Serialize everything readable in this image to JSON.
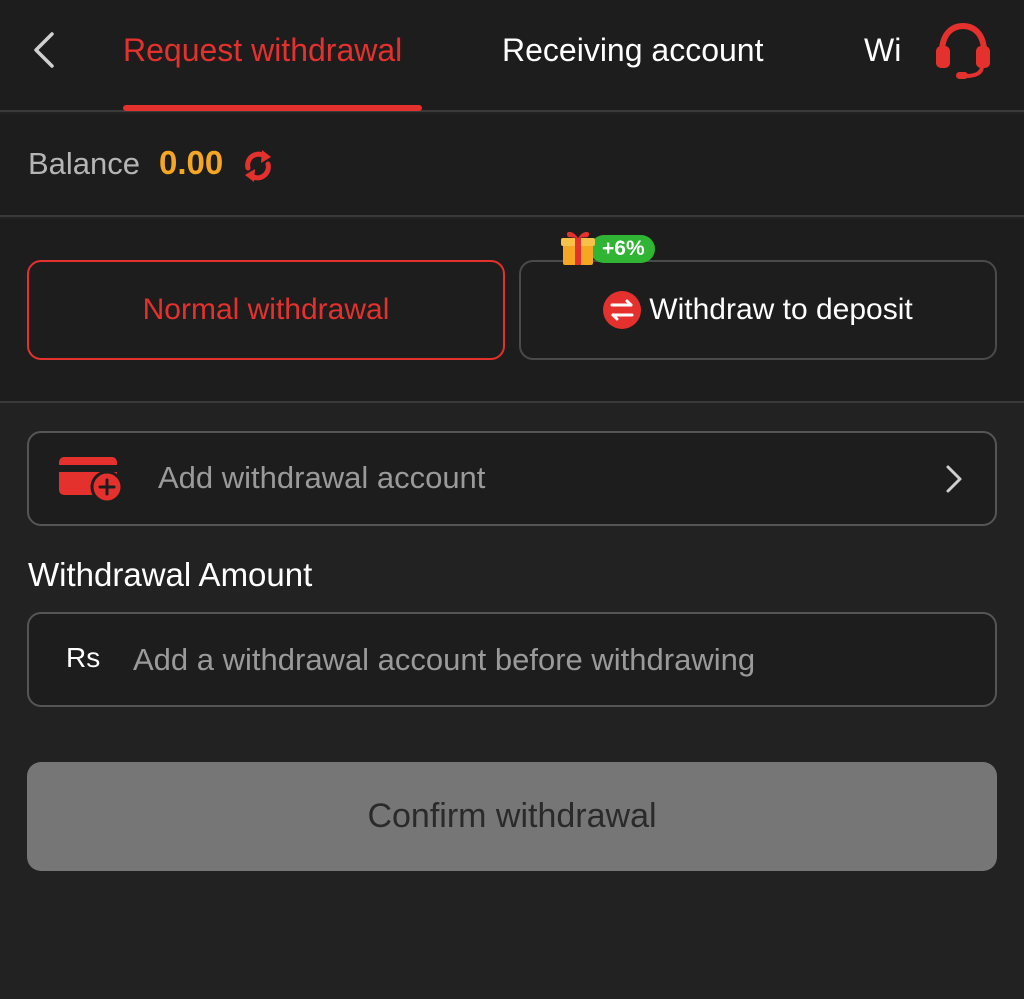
{
  "header": {
    "tabs": [
      {
        "label": "Request withdrawal",
        "active": true
      },
      {
        "label": "Receiving account",
        "active": false
      },
      {
        "label": "Wi",
        "active": false
      }
    ],
    "back_icon": "chevron-left-icon",
    "support_icon": "headset-icon"
  },
  "balance": {
    "label": "Balance",
    "value": "0.00",
    "refresh_icon": "refresh-icon"
  },
  "methods": {
    "normal_label": "Normal withdrawal",
    "deposit_label": "Withdraw to deposit",
    "bonus": "+6%",
    "selected": "normal"
  },
  "account": {
    "placeholder": "Add withdrawal account"
  },
  "amount": {
    "label": "Withdrawal Amount",
    "currency": "Rs",
    "placeholder": "Add a withdrawal account before withdrawing",
    "value": ""
  },
  "confirm": {
    "label": "Confirm withdrawal",
    "enabled": false
  },
  "colors": {
    "accent": "#e5312e",
    "balance": "#f5a623",
    "bonus": "#2fb533",
    "background": "#222222",
    "disabled_button": "#767676"
  }
}
